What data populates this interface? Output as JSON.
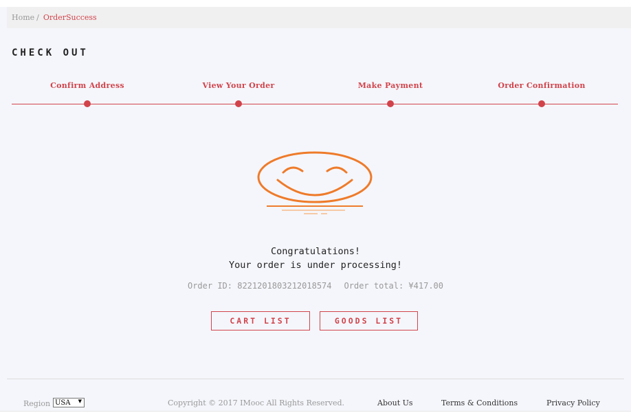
{
  "breadcrumb": {
    "home": "Home",
    "separator": "/",
    "current": "OrderSuccess"
  },
  "page_title": "CHECK OUT",
  "steps": [
    {
      "label": "Confirm Address"
    },
    {
      "label": "View Your Order"
    },
    {
      "label": "Make Payment"
    },
    {
      "label": "Order Confirmation"
    }
  ],
  "success": {
    "icon": "smile-icon",
    "line1": "Congratulations!",
    "line2": "Your order is under processing!",
    "order_id_text": "Order ID: 822120180321201857",
    "order_id_suffix": "4",
    "order_total_text": "Order total: ¥417.00"
  },
  "buttons": {
    "cart_list": "CART LIST",
    "goods_list": "GOODS LIST"
  },
  "footer": {
    "region_label": "Region",
    "region_value": "USA",
    "copyright": "Copyright © 2017 IMooc All Rights Reserved.",
    "about": "About Us",
    "terms": "Terms & Conditions",
    "privacy": "Privacy Policy"
  },
  "colors": {
    "accent": "#d1434b",
    "smile": "#ee7b2a",
    "smile_light": "#f6c9a6",
    "background": "#f5f6fb"
  }
}
